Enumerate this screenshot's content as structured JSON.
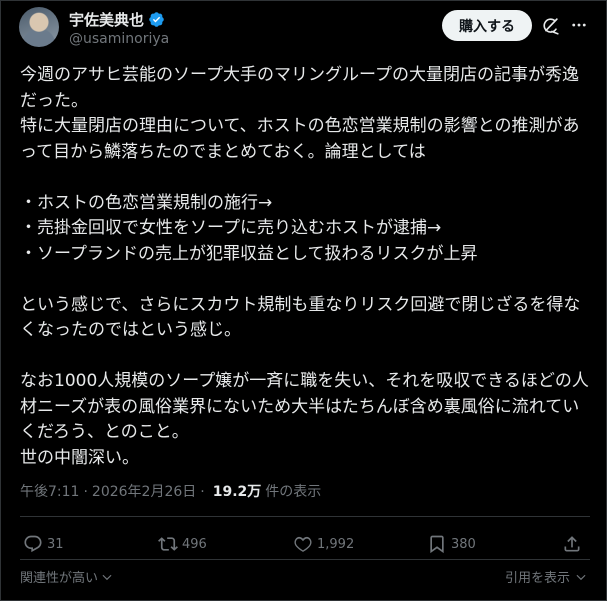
{
  "author": {
    "display_name": "宇佐美典也",
    "handle": "@usaminoriya",
    "verified": true
  },
  "header": {
    "subscribe_label": "購入する"
  },
  "icons": {
    "verified": "verified-badge-icon",
    "grok": "grok-icon",
    "more": "more-icon",
    "reply": "reply-icon",
    "repost": "repost-icon",
    "like": "like-icon",
    "bookmark": "bookmark-icon",
    "share": "share-icon",
    "chevron": "chevron-down-icon"
  },
  "post": {
    "lines": [
      "今週のアサヒ芸能のソープ大手のマリングループの大量閉店の記事が秀逸だった。",
      "特に大量閉店の理由について、ホストの色恋営業規制の影響との推測があって目から鱗落ちたのでまとめておく。論理としては",
      "",
      "・ホストの色恋営業規制の施行→",
      "・売掛金回収で女性をソープに売り込むホストが逮捕→",
      "・ソープランドの売上が犯罪収益として扱わるリスクが上昇",
      "",
      "という感じで、さらにスカウト規制も重なりリスク回避で閉じざるを得なくなったのではという感じ。",
      "",
      "なお1000人規模のソープ嬢が一斉に職を失い、それを吸収できるほどの人材ニーズが表の風俗業界にないため大半はたちんぼ含め裏風俗に流れていくだろう、とのこと。",
      "世の中闇深い。"
    ]
  },
  "meta": {
    "time": "午後7:11",
    "separator": "·",
    "date": "2026年2月26日",
    "views_count": "19.2万",
    "views_label": "件の表示"
  },
  "actions": {
    "replies": "31",
    "reposts": "496",
    "likes": "1,992",
    "bookmarks": "380"
  },
  "footer": {
    "sort_label": "関連性が高い",
    "quotes_label": "引用を表示"
  },
  "colors": {
    "background": "#000000",
    "text": "#e7e9ea",
    "secondary": "#71767b",
    "verified": "#1d9bf0",
    "divider": "#2f3336"
  }
}
